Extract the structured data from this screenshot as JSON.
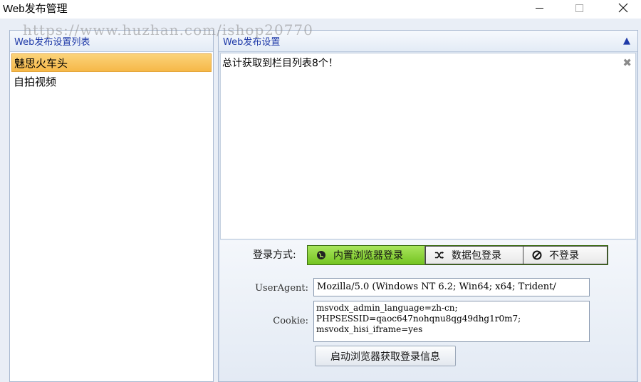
{
  "window": {
    "title": "Web发布管理"
  },
  "watermark": "https://www.huzhan.com/ishop20770",
  "left_panel": {
    "header": "Web发布设置列表",
    "items": [
      {
        "label": "魅思火车头",
        "selected": true
      },
      {
        "label": "自拍视频",
        "selected": false
      }
    ]
  },
  "right_panel": {
    "header": "Web发布设置",
    "log_text": "总计获取到栏目列表8个！",
    "login_method_label": "登录方式:",
    "login_options": [
      {
        "label": "内置浏览器登录",
        "icon": "globe-icon",
        "active": true
      },
      {
        "label": "数据包登录",
        "icon": "shuffle-icon",
        "active": false
      },
      {
        "label": "不登录",
        "icon": "no-entry-icon",
        "active": false
      }
    ],
    "useragent_label": "UserAgent:",
    "useragent_value": "Mozilla/5.0 (Windows NT 6.2; Win64; x64; Trident/",
    "cookie_label": "Cookie:",
    "cookie_lines": [
      "msvodx_admin_language=zh-cn;",
      "PHPSESSID=qaoc647nohqnu8qg49dhg1r0m7;",
      "msvodx_hisi_iframe=yes"
    ],
    "fetch_button": "启动浏览器获取登录信息"
  },
  "colors": {
    "selected": "#f6b848",
    "active_button": "#74c421",
    "header_text": "#1f3aa8"
  }
}
